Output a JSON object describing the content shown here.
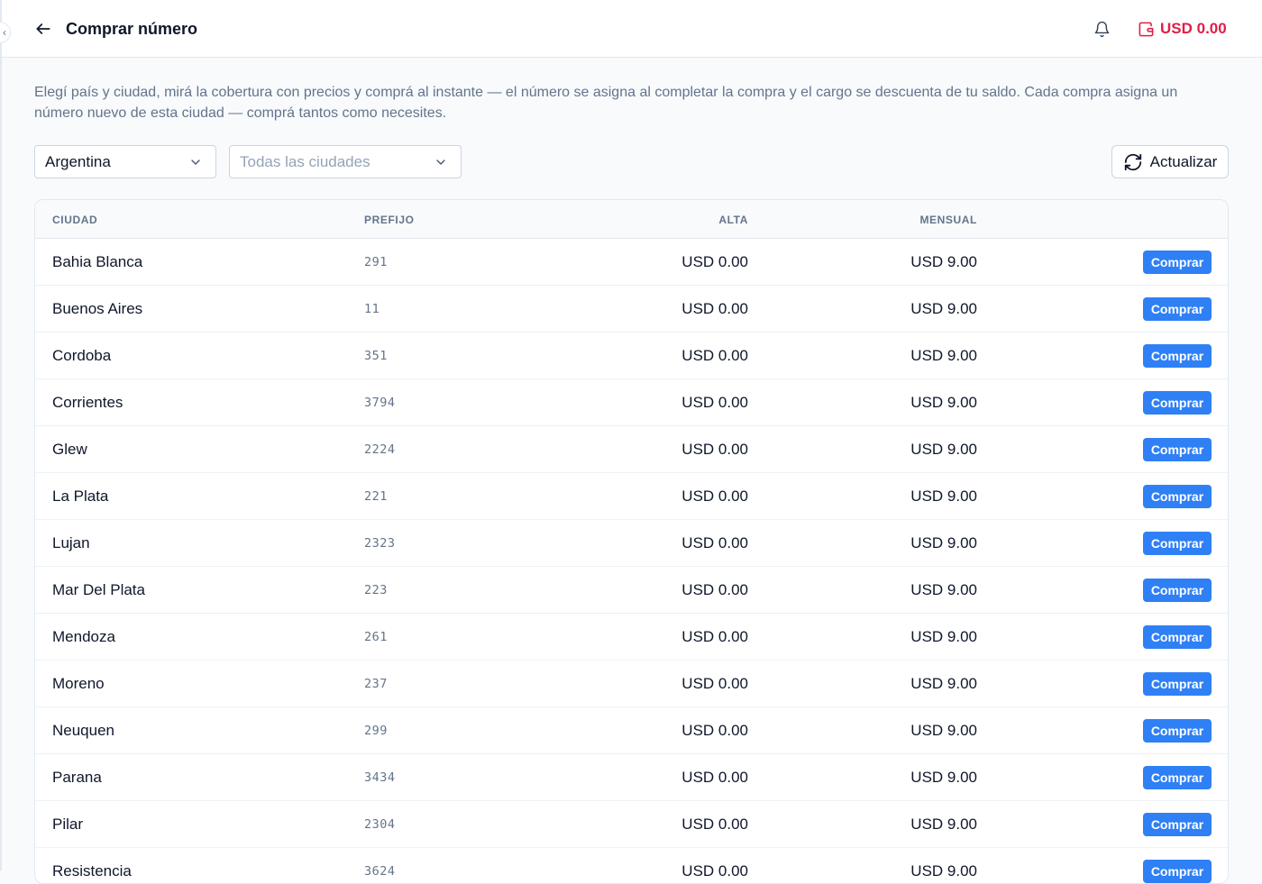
{
  "header": {
    "title": "Comprar número",
    "balance": "USD 0.00",
    "collapse_glyph": "‹"
  },
  "description": "Elegí país y ciudad, mirá la cobertura con precios y comprá al instante — el número se asigna al completar la compra y el cargo se descuenta de tu saldo. Cada compra asigna un número nuevo de esta ciudad — comprá tantos como necesites.",
  "filters": {
    "country_value": "Argentina",
    "city_placeholder": "Todas las ciudades",
    "refresh_label": "Actualizar"
  },
  "table": {
    "columns": {
      "city": "CIUDAD",
      "prefix": "PREFIJO",
      "alta": "ALTA",
      "mensual": "MENSUAL"
    },
    "rows": [
      {
        "city": "Bahia Blanca",
        "prefix": "291",
        "alta": "USD 0.00",
        "mensual": "USD 9.00",
        "action": "Comprar"
      },
      {
        "city": "Buenos Aires",
        "prefix": "11",
        "alta": "USD 0.00",
        "mensual": "USD 9.00",
        "action": "Comprar"
      },
      {
        "city": "Cordoba",
        "prefix": "351",
        "alta": "USD 0.00",
        "mensual": "USD 9.00",
        "action": "Comprar"
      },
      {
        "city": "Corrientes",
        "prefix": "3794",
        "alta": "USD 0.00",
        "mensual": "USD 9.00",
        "action": "Comprar"
      },
      {
        "city": "Glew",
        "prefix": "2224",
        "alta": "USD 0.00",
        "mensual": "USD 9.00",
        "action": "Comprar"
      },
      {
        "city": "La Plata",
        "prefix": "221",
        "alta": "USD 0.00",
        "mensual": "USD 9.00",
        "action": "Comprar"
      },
      {
        "city": "Lujan",
        "prefix": "2323",
        "alta": "USD 0.00",
        "mensual": "USD 9.00",
        "action": "Comprar"
      },
      {
        "city": "Mar Del Plata",
        "prefix": "223",
        "alta": "USD 0.00",
        "mensual": "USD 9.00",
        "action": "Comprar"
      },
      {
        "city": "Mendoza",
        "prefix": "261",
        "alta": "USD 0.00",
        "mensual": "USD 9.00",
        "action": "Comprar"
      },
      {
        "city": "Moreno",
        "prefix": "237",
        "alta": "USD 0.00",
        "mensual": "USD 9.00",
        "action": "Comprar"
      },
      {
        "city": "Neuquen",
        "prefix": "299",
        "alta": "USD 0.00",
        "mensual": "USD 9.00",
        "action": "Comprar"
      },
      {
        "city": "Parana",
        "prefix": "3434",
        "alta": "USD 0.00",
        "mensual": "USD 9.00",
        "action": "Comprar"
      },
      {
        "city": "Pilar",
        "prefix": "2304",
        "alta": "USD 0.00",
        "mensual": "USD 9.00",
        "action": "Comprar"
      },
      {
        "city": "Resistencia",
        "prefix": "3624",
        "alta": "USD 0.00",
        "mensual": "USD 9.00",
        "action": "Comprar"
      }
    ]
  },
  "icons": {
    "back": "arrow-left-icon",
    "bell": "bell-icon",
    "wallet": "wallet-icon",
    "chevron": "chevron-down-icon",
    "refresh": "refresh-icon"
  },
  "colors": {
    "accent": "#2f80f5",
    "balance": "#e11d48"
  }
}
